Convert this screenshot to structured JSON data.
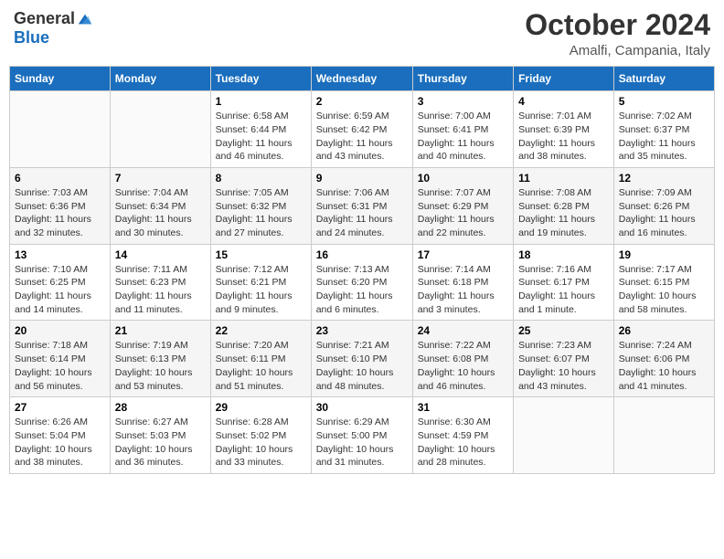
{
  "logo": {
    "general": "General",
    "blue": "Blue"
  },
  "header": {
    "title": "October 2024",
    "subtitle": "Amalfi, Campania, Italy"
  },
  "days_of_week": [
    "Sunday",
    "Monday",
    "Tuesday",
    "Wednesday",
    "Thursday",
    "Friday",
    "Saturday"
  ],
  "weeks": [
    [
      {
        "day": "",
        "info": ""
      },
      {
        "day": "",
        "info": ""
      },
      {
        "day": "1",
        "info": "Sunrise: 6:58 AM\nSunset: 6:44 PM\nDaylight: 11 hours and 46 minutes."
      },
      {
        "day": "2",
        "info": "Sunrise: 6:59 AM\nSunset: 6:42 PM\nDaylight: 11 hours and 43 minutes."
      },
      {
        "day": "3",
        "info": "Sunrise: 7:00 AM\nSunset: 6:41 PM\nDaylight: 11 hours and 40 minutes."
      },
      {
        "day": "4",
        "info": "Sunrise: 7:01 AM\nSunset: 6:39 PM\nDaylight: 11 hours and 38 minutes."
      },
      {
        "day": "5",
        "info": "Sunrise: 7:02 AM\nSunset: 6:37 PM\nDaylight: 11 hours and 35 minutes."
      }
    ],
    [
      {
        "day": "6",
        "info": "Sunrise: 7:03 AM\nSunset: 6:36 PM\nDaylight: 11 hours and 32 minutes."
      },
      {
        "day": "7",
        "info": "Sunrise: 7:04 AM\nSunset: 6:34 PM\nDaylight: 11 hours and 30 minutes."
      },
      {
        "day": "8",
        "info": "Sunrise: 7:05 AM\nSunset: 6:32 PM\nDaylight: 11 hours and 27 minutes."
      },
      {
        "day": "9",
        "info": "Sunrise: 7:06 AM\nSunset: 6:31 PM\nDaylight: 11 hours and 24 minutes."
      },
      {
        "day": "10",
        "info": "Sunrise: 7:07 AM\nSunset: 6:29 PM\nDaylight: 11 hours and 22 minutes."
      },
      {
        "day": "11",
        "info": "Sunrise: 7:08 AM\nSunset: 6:28 PM\nDaylight: 11 hours and 19 minutes."
      },
      {
        "day": "12",
        "info": "Sunrise: 7:09 AM\nSunset: 6:26 PM\nDaylight: 11 hours and 16 minutes."
      }
    ],
    [
      {
        "day": "13",
        "info": "Sunrise: 7:10 AM\nSunset: 6:25 PM\nDaylight: 11 hours and 14 minutes."
      },
      {
        "day": "14",
        "info": "Sunrise: 7:11 AM\nSunset: 6:23 PM\nDaylight: 11 hours and 11 minutes."
      },
      {
        "day": "15",
        "info": "Sunrise: 7:12 AM\nSunset: 6:21 PM\nDaylight: 11 hours and 9 minutes."
      },
      {
        "day": "16",
        "info": "Sunrise: 7:13 AM\nSunset: 6:20 PM\nDaylight: 11 hours and 6 minutes."
      },
      {
        "day": "17",
        "info": "Sunrise: 7:14 AM\nSunset: 6:18 PM\nDaylight: 11 hours and 3 minutes."
      },
      {
        "day": "18",
        "info": "Sunrise: 7:16 AM\nSunset: 6:17 PM\nDaylight: 11 hours and 1 minute."
      },
      {
        "day": "19",
        "info": "Sunrise: 7:17 AM\nSunset: 6:15 PM\nDaylight: 10 hours and 58 minutes."
      }
    ],
    [
      {
        "day": "20",
        "info": "Sunrise: 7:18 AM\nSunset: 6:14 PM\nDaylight: 10 hours and 56 minutes."
      },
      {
        "day": "21",
        "info": "Sunrise: 7:19 AM\nSunset: 6:13 PM\nDaylight: 10 hours and 53 minutes."
      },
      {
        "day": "22",
        "info": "Sunrise: 7:20 AM\nSunset: 6:11 PM\nDaylight: 10 hours and 51 minutes."
      },
      {
        "day": "23",
        "info": "Sunrise: 7:21 AM\nSunset: 6:10 PM\nDaylight: 10 hours and 48 minutes."
      },
      {
        "day": "24",
        "info": "Sunrise: 7:22 AM\nSunset: 6:08 PM\nDaylight: 10 hours and 46 minutes."
      },
      {
        "day": "25",
        "info": "Sunrise: 7:23 AM\nSunset: 6:07 PM\nDaylight: 10 hours and 43 minutes."
      },
      {
        "day": "26",
        "info": "Sunrise: 7:24 AM\nSunset: 6:06 PM\nDaylight: 10 hours and 41 minutes."
      }
    ],
    [
      {
        "day": "27",
        "info": "Sunrise: 6:26 AM\nSunset: 5:04 PM\nDaylight: 10 hours and 38 minutes."
      },
      {
        "day": "28",
        "info": "Sunrise: 6:27 AM\nSunset: 5:03 PM\nDaylight: 10 hours and 36 minutes."
      },
      {
        "day": "29",
        "info": "Sunrise: 6:28 AM\nSunset: 5:02 PM\nDaylight: 10 hours and 33 minutes."
      },
      {
        "day": "30",
        "info": "Sunrise: 6:29 AM\nSunset: 5:00 PM\nDaylight: 10 hours and 31 minutes."
      },
      {
        "day": "31",
        "info": "Sunrise: 6:30 AM\nSunset: 4:59 PM\nDaylight: 10 hours and 28 minutes."
      },
      {
        "day": "",
        "info": ""
      },
      {
        "day": "",
        "info": ""
      }
    ]
  ]
}
